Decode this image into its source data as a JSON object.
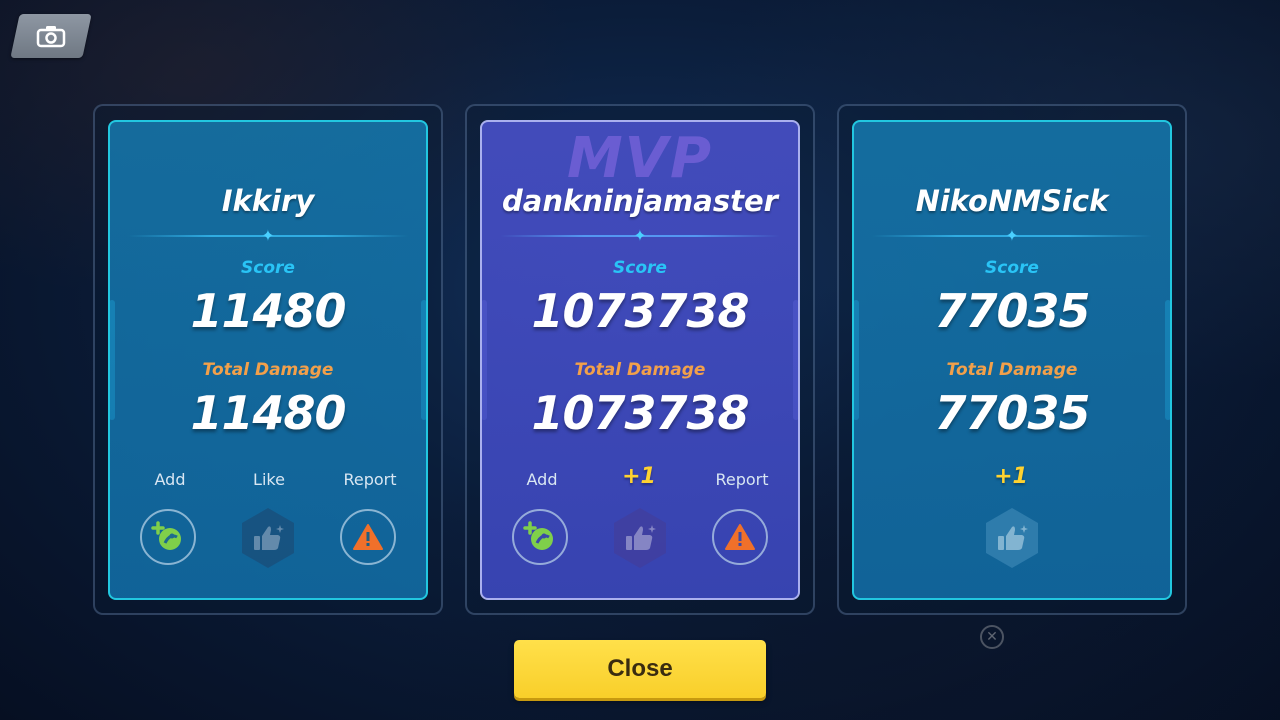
{
  "header": {
    "screenshot_icon": "camera-icon"
  },
  "cards": [
    {
      "name": "Ikkiry",
      "score_label": "Score",
      "score": "11480",
      "damage_label": "Total Damage",
      "damage": "11480",
      "mvp": false,
      "actions": {
        "add_label": "Add",
        "like_label": "Like",
        "report_label": "Report"
      }
    },
    {
      "mvp_badge": "MVP",
      "name": "dankninjamaster",
      "score_label": "Score",
      "score": "1073738",
      "damage_label": "Total Damage",
      "damage": "1073738",
      "mvp": true,
      "actions": {
        "add_label": "Add",
        "like_count": "+1",
        "report_label": "Report"
      }
    },
    {
      "name": "NikoNMSick",
      "score_label": "Score",
      "score": "77035",
      "damage_label": "Total Damage",
      "damage": "77035",
      "mvp": false,
      "actions": {
        "like_count": "+1"
      }
    }
  ],
  "footer": {
    "close_label": "Close",
    "close_color": "#fbd836"
  },
  "colors": {
    "score_label": "#29c4f6",
    "damage_label": "#f2a04a",
    "plus_one": "#ffd230",
    "teal_card": "#1a7db4",
    "mvp_card": "#4850c8"
  }
}
